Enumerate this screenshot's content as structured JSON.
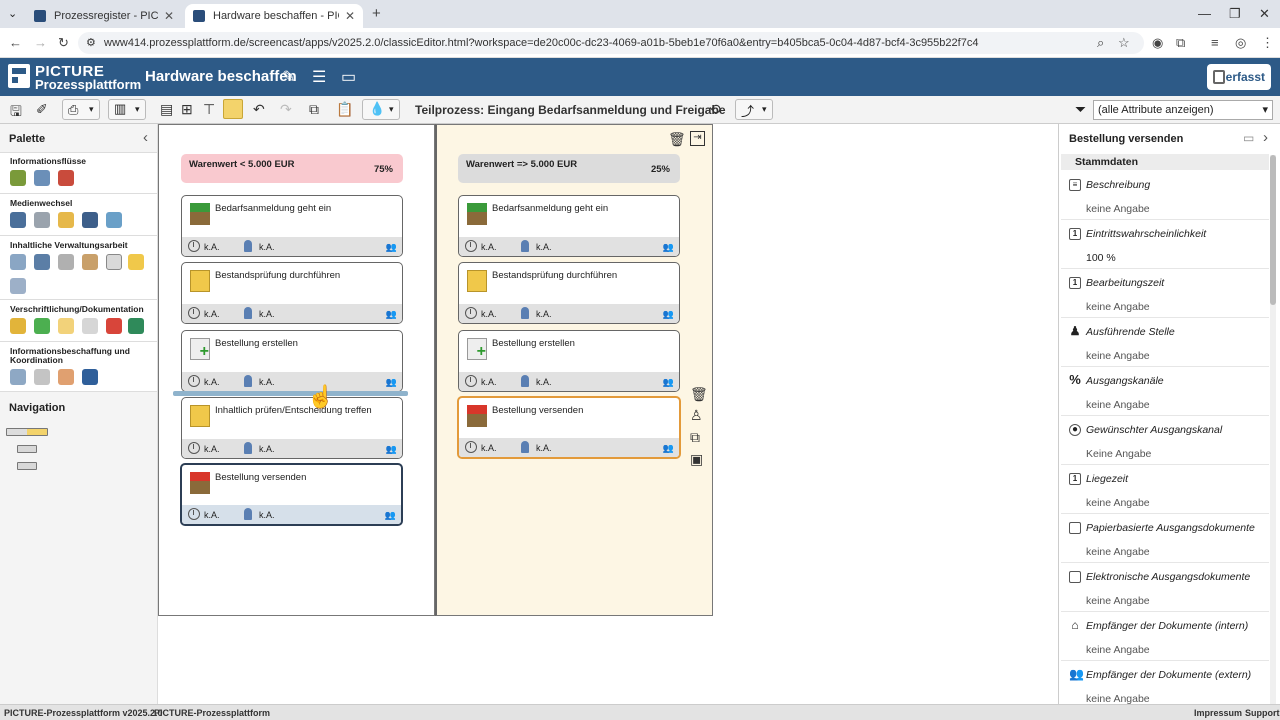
{
  "browser": {
    "tabs": [
      {
        "label": "Prozessregister - PICTURE-Proz"
      },
      {
        "label": "Hardware beschaffen - PICTUR"
      }
    ],
    "url": "www414.prozessplattform.de/screencast/apps/v2025.2.0/classicEditor.html?workspace=de20c00c-dc23-4069-a01b-5beb1e70f6a0&entry=b405bca5-0c04-4d87-bcf4-3c955b22f7c4"
  },
  "app": {
    "brand_line1": "PICTURE",
    "brand_line2": "Prozessplattform",
    "title": "Hardware beschaffen",
    "status": "erfasst"
  },
  "toolbar": {
    "subprocess_title": "Teilprozess: Eingang Bedarfsanmeldung und Freigabe",
    "filter_value": "(alle Attribute anzeigen)"
  },
  "palette": {
    "title": "Palette",
    "sections": [
      {
        "title": "Informationsflüsse"
      },
      {
        "title": "Medienwechsel"
      },
      {
        "title": "Inhaltliche Verwaltungsarbeit"
      },
      {
        "title": "Verschriftlichung/Dokumentation"
      },
      {
        "title": "Informationsbeschaffung und Koordination"
      }
    ],
    "navigation_title": "Navigation"
  },
  "lanes": [
    {
      "name": "Warenwert < 5.000 EUR",
      "percent": "75%",
      "color": "#f9c9cf",
      "cards": [
        {
          "title": "Bedarfsanmeldung geht ein",
          "time": "k.A.",
          "role": "k.A.",
          "icon": "inbox-green-arrow-icon"
        },
        {
          "title": "Bestandsprüfung durchführen",
          "time": "k.A.",
          "role": "k.A.",
          "icon": "document-yellow-icon"
        },
        {
          "title": "Bestellung erstellen",
          "time": "k.A.",
          "role": "k.A.",
          "icon": "document-plus-icon"
        },
        {
          "title": "Inhaltlich prüfen/Entscheidung treffen",
          "time": "k.A.",
          "role": "k.A.",
          "icon": "document-yellow-icon"
        },
        {
          "title": "Bestellung versenden",
          "time": "k.A.",
          "role": "k.A.",
          "icon": "outbox-red-arrow-icon"
        }
      ]
    },
    {
      "name": "Warenwert => 5.000 EUR",
      "percent": "25%",
      "color": "#dcdcdc",
      "cards": [
        {
          "title": "Bedarfsanmeldung geht ein",
          "time": "k.A.",
          "role": "k.A.",
          "icon": "inbox-green-arrow-icon"
        },
        {
          "title": "Bestandsprüfung durchführen",
          "time": "k.A.",
          "role": "k.A.",
          "icon": "document-yellow-icon"
        },
        {
          "title": "Bestellung erstellen",
          "time": "k.A.",
          "role": "k.A.",
          "icon": "document-plus-icon"
        },
        {
          "title": "Bestellung versenden",
          "time": "k.A.",
          "role": "k.A.",
          "icon": "outbox-red-arrow-icon"
        }
      ]
    }
  ],
  "properties": {
    "title": "Bestellung versenden",
    "section": "Stammdaten",
    "rows": [
      {
        "label": "Beschreibung",
        "value": "keine Angabe",
        "icon": "text-icon"
      },
      {
        "label": "Eintrittswahrscheinlichkeit",
        "value": "100 %",
        "icon": "number-icon"
      },
      {
        "label": "Bearbeitungszeit",
        "value": "keine Angabe",
        "icon": "number-icon"
      },
      {
        "label": "Ausführende Stelle",
        "value": "keine Angabe",
        "icon": "person-icon"
      },
      {
        "label": "Ausgangskanäle",
        "value": "keine Angabe",
        "icon": "percent-icon"
      },
      {
        "label": "Gewünschter Ausgangskanal",
        "value": "Keine Angabe",
        "icon": "radio-icon"
      },
      {
        "label": "Liegezeit",
        "value": "keine Angabe",
        "icon": "number-icon"
      },
      {
        "label": "Papierbasierte Ausgangsdokumente",
        "value": "keine Angabe",
        "icon": "document-icon"
      },
      {
        "label": "Elektronische Ausgangsdokumente",
        "value": "keine Angabe",
        "icon": "document-icon"
      },
      {
        "label": "Empfänger der Dokumente (intern)",
        "value": "keine Angabe",
        "icon": "building-icon"
      },
      {
        "label": "Empfänger der Dokumente (extern)",
        "value": "keine Angabe",
        "icon": "people-icon"
      }
    ]
  },
  "footer": {
    "version": "PICTURE-Prozessplattform v2025.2.0",
    "product": "PICTURE-Prozessplattform",
    "impressum": "Impressum",
    "support": "Support"
  }
}
